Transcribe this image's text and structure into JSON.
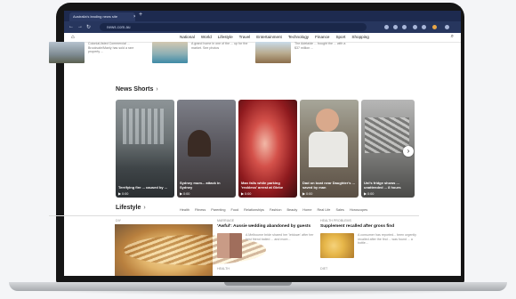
{
  "browser": {
    "tab_title": "Australia's leading news site",
    "tab_close": "×",
    "new_tab": "+",
    "url": "news.com.au",
    "nav_back": "←",
    "nav_forward": "→",
    "nav_reload": "↻"
  },
  "site_nav": {
    "home_icon": "⌂",
    "search_icon": "⌕",
    "sections": [
      "National",
      "World",
      "Lifestyle",
      "Travel",
      "Entertainment",
      "Technology",
      "Finance",
      "Sport",
      "Shopping"
    ]
  },
  "top_stories": [
    {
      "text": "Colonial-listed Commercial ... Brookvale/Manly has sold a rare property ..."
    },
    {
      "text": "A grand home in one of the ... up for the market. See photos"
    },
    {
      "text": "The Adelaide ... bought the ... with a $37 million ..."
    }
  ],
  "news_shorts": {
    "title": "News Shorts",
    "chevron": "›",
    "next": "›",
    "cards": [
      {
        "caption": "Terrifying fire ... caused by ...",
        "play": "▶ 0:00"
      },
      {
        "caption": "Sydney mum... attack in Sydney",
        "play": "▶ 0:00"
      },
      {
        "caption": "Man falls while parking 'reckless' arrest at Glebe",
        "play": "▶ 0:00"
      },
      {
        "caption": "Dad on boat near Daughter's ... saved by man",
        "play": "▶ 0:00"
      },
      {
        "caption": "Uni's fridge shows ... unattended ... 8 hours",
        "play": "▶ 0:00"
      }
    ]
  },
  "lifestyle": {
    "title": "Lifestyle",
    "chevron": "›",
    "tags": [
      "Health",
      "Fitness",
      "Parenting",
      "Food",
      "Relationships",
      "Fashion",
      "Beauty",
      "Home",
      "Real Life",
      "Sales",
      "Horoscopes"
    ],
    "left_label": "DIY",
    "mid_label": "MARRIAGE",
    "right_label": "HEALTH PROBLEMS",
    "bottom_mid_label": "HEALTH",
    "bottom_right_label": "DIET",
    "mid_story": {
      "headline": "'Awful': Aussie wedding abandoned by guests",
      "sub": "A Melbourne bride shared her 'letdown' after her best friend bailed ... and more..."
    },
    "right_story": {
      "headline": "Supplement recalled after gross find",
      "sub": "A consumer has reported... been urgently recalled after the find ... was found ... a bottle..."
    }
  },
  "colors": {
    "tabbar": "#1d2a4f",
    "urlbar": "#27365e",
    "laptop_bezel": "#151515"
  }
}
